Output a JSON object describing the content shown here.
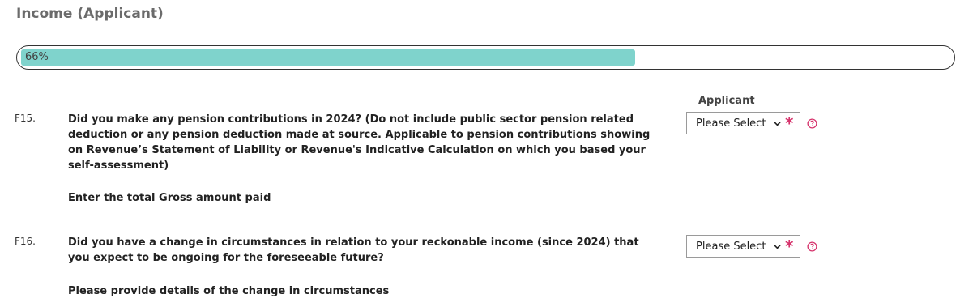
{
  "section": {
    "title": "Income (Applicant)"
  },
  "progress": {
    "label": "66%",
    "value": 0.66
  },
  "columns": {
    "applicant_header": "Applicant"
  },
  "questions": [
    {
      "number": "F15.",
      "text": "Did you make any pension contributions in 2024? (Do not include public sector pension related deduction or any pension deduction made at source. Applicable to pension contributions showing on Revenue’s Statement of Liability or Revenue's Indicative Calculation on which you based your self-assessment)",
      "subtext": "Enter the total Gross amount paid",
      "select_value": "Please Select",
      "required_mark": "*"
    },
    {
      "number": "F16.",
      "text": "Did you have a change in circumstances in relation to your reckonable income (since 2024) that you expect to be ongoing for the foreseeable future?",
      "subtext": "Please provide details of the change in circumstances",
      "select_value": "Please Select",
      "required_mark": "*"
    }
  ],
  "icons": {
    "help": "help-circle-icon",
    "dropdown": "chevron-down-icon"
  },
  "colors": {
    "progress_fill": "#7fd3cc",
    "required": "#d6336c",
    "help": "#d6336c",
    "title": "#6b6b6b"
  }
}
